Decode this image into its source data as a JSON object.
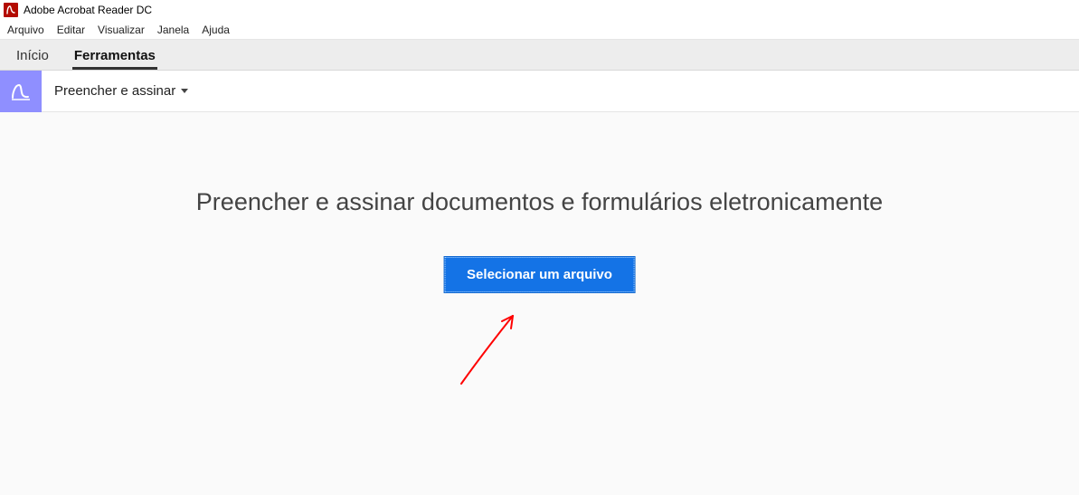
{
  "title_bar": {
    "app_name": "Adobe Acrobat Reader DC"
  },
  "menu": {
    "items": [
      "Arquivo",
      "Editar",
      "Visualizar",
      "Janela",
      "Ajuda"
    ]
  },
  "tabs": {
    "items": [
      {
        "label": "Início",
        "active": false
      },
      {
        "label": "Ferramentas",
        "active": true
      }
    ]
  },
  "tool_row": {
    "dropdown_label": "Preencher e assinar"
  },
  "content": {
    "heading": "Preencher e assinar documentos e formulários eletronicamente",
    "select_button": "Selecionar um arquivo"
  }
}
